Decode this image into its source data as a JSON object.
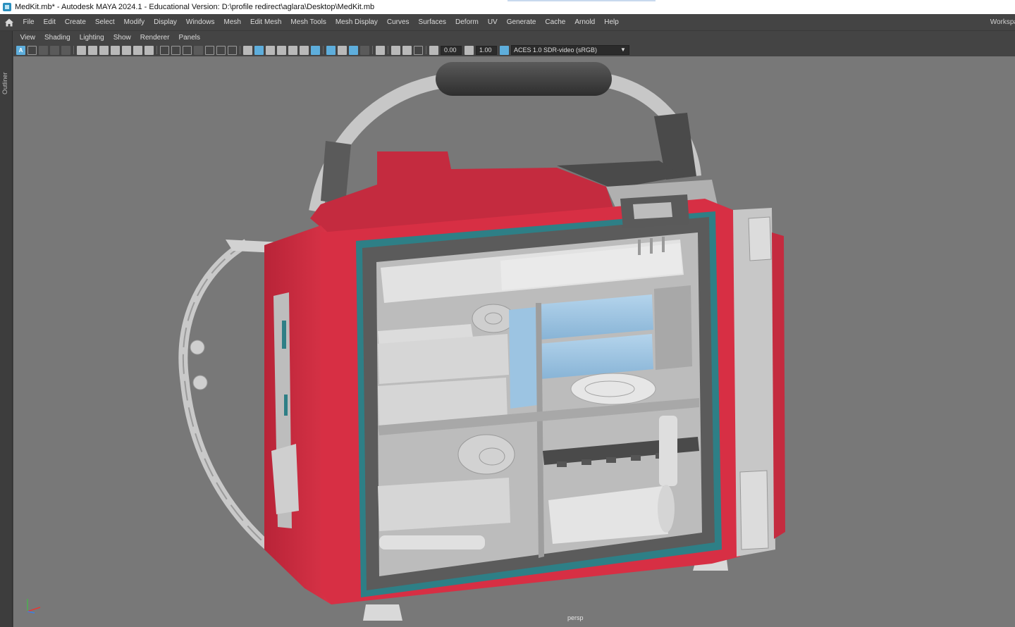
{
  "window": {
    "title": "MedKit.mb* - Autodesk MAYA 2024.1 - Educational Version: D:\\profile redirect\\aglara\\Desktop\\MedKit.mb"
  },
  "menubar": {
    "items": [
      "File",
      "Edit",
      "Create",
      "Select",
      "Modify",
      "Display",
      "Windows",
      "Mesh",
      "Edit Mesh",
      "Mesh Tools",
      "Mesh Display",
      "Curves",
      "Surfaces",
      "Deform",
      "UV",
      "Generate",
      "Cache",
      "Arnold",
      "Help"
    ],
    "workspace_label": "Workspa"
  },
  "outliner": {
    "label": "Outliner"
  },
  "panel_menu": {
    "items": [
      "View",
      "Shading",
      "Lighting",
      "Show",
      "Renderer",
      "Panels"
    ]
  },
  "panel_toolbar": {
    "exposure": "0.00",
    "gamma": "1.00",
    "color_space": "ACES 1.0 SDR-video (sRGB)"
  },
  "viewport": {
    "camera": "persp",
    "background_color": "#787878",
    "model_colors": {
      "body": "#d72f44",
      "trim": "#2e7f86",
      "handle": "#3d3d3d",
      "interior": "#d2d2d2",
      "glass": "#9cc4e2"
    }
  }
}
